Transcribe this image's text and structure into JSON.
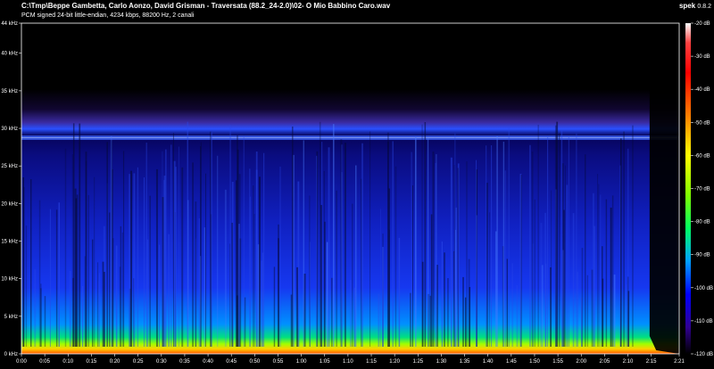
{
  "file": {
    "path": "C:\\Tmp\\Beppe Gambetta, Carlo Aonzo, David Grisman - Traversata (88.2_24-2.0)\\02- O Mio Babbino Caro.wav",
    "info": "PCM signed 24-bit little-endian, 4234 kbps, 88200 Hz, 2 canali"
  },
  "app": {
    "name": "spek",
    "version": "0.8.2"
  },
  "frequency_axis": {
    "labels": [
      "44 kHz",
      "40 kHz",
      "35 kHz",
      "30 kHz",
      "25 kHz",
      "20 kHz",
      "15 kHz",
      "10 kHz",
      "5 kHz",
      "0 kHz"
    ],
    "values_khz": [
      44,
      40,
      35,
      30,
      25,
      20,
      15,
      10,
      5,
      0
    ],
    "max_khz": 44
  },
  "time_axis": {
    "labels": [
      "0:00",
      "0:05",
      "0:10",
      "0:15",
      "0:20",
      "0:25",
      "0:30",
      "0:35",
      "0:40",
      "0:45",
      "0:50",
      "0:55",
      "1:00",
      "1:05",
      "1:10",
      "1:15",
      "1:20",
      "1:25",
      "1:30",
      "1:35",
      "1:40",
      "1:45",
      "1:50",
      "1:55",
      "2:00",
      "2:05",
      "2:10",
      "2:15",
      "2:21"
    ],
    "values_s": [
      0,
      5,
      10,
      15,
      20,
      25,
      30,
      35,
      40,
      45,
      50,
      55,
      60,
      65,
      70,
      75,
      80,
      85,
      90,
      95,
      100,
      105,
      110,
      115,
      120,
      125,
      130,
      135,
      141
    ],
    "duration_s": 141
  },
  "db_scale": {
    "labels": [
      "-20 dB",
      "-30 dB",
      "-40 dB",
      "-50 dB",
      "-60 dB",
      "-70 dB",
      "-80 dB",
      "-90 dB",
      "-100 dB",
      "-110 dB",
      "-120 dB"
    ],
    "values_db": [
      -20,
      -30,
      -40,
      -50,
      -60,
      -70,
      -80,
      -90,
      -100,
      -110,
      -120
    ]
  },
  "colors": {
    "gradient": [
      "#ffffff",
      "#ff4040",
      "#ff0000",
      "#ff8000",
      "#ffff00",
      "#80ff00",
      "#00ff60",
      "#00a0ff",
      "#0000ff",
      "#300090",
      "#000000"
    ]
  }
}
